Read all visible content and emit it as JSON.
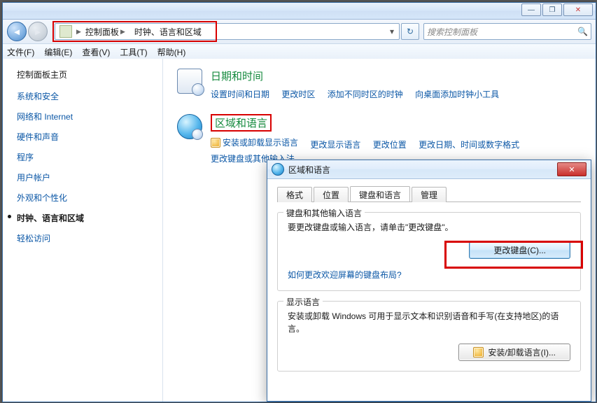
{
  "titlebar": {
    "min": "—",
    "max": "❐",
    "close": "✕"
  },
  "nav": {
    "crumb1": "控制面板",
    "crumb2": "时钟、语言和区域",
    "search_placeholder": "搜索控制面板"
  },
  "menu": {
    "file": "文件(F)",
    "edit": "编辑(E)",
    "view": "查看(V)",
    "tools": "工具(T)",
    "help": "帮助(H)"
  },
  "side": {
    "home": "控制面板主页",
    "items": [
      "系统和安全",
      "网络和 Internet",
      "硬件和声音",
      "程序",
      "用户帐户",
      "外观和个性化",
      "时钟、语言和区域",
      "轻松访问"
    ]
  },
  "cats": [
    {
      "title": "日期和时间",
      "links": [
        "设置时间和日期",
        "更改时区",
        "添加不同时区的时钟",
        "向桌面添加时钟小工具"
      ]
    },
    {
      "title": "区域和语言",
      "links": [
        "安装或卸载显示语言",
        "更改显示语言",
        "更改位置",
        "更改日期、时间或数字格式",
        "更改键盘或其他输入法"
      ]
    }
  ],
  "dialog": {
    "title": "区域和语言",
    "tabs": [
      "格式",
      "位置",
      "键盘和语言",
      "管理"
    ],
    "g1": {
      "legend": "键盘和其他输入语言",
      "text": "要更改键盘或输入语言，请单击\"更改键盘\"。",
      "btn": "更改键盘(C)...",
      "link": "如何更改欢迎屏幕的键盘布局?"
    },
    "g2": {
      "legend": "显示语言",
      "text": "安装或卸载 Windows 可用于显示文本和识别语音和手写(在支持地区)的语言。",
      "btn": "安装/卸载语言(I)..."
    }
  }
}
